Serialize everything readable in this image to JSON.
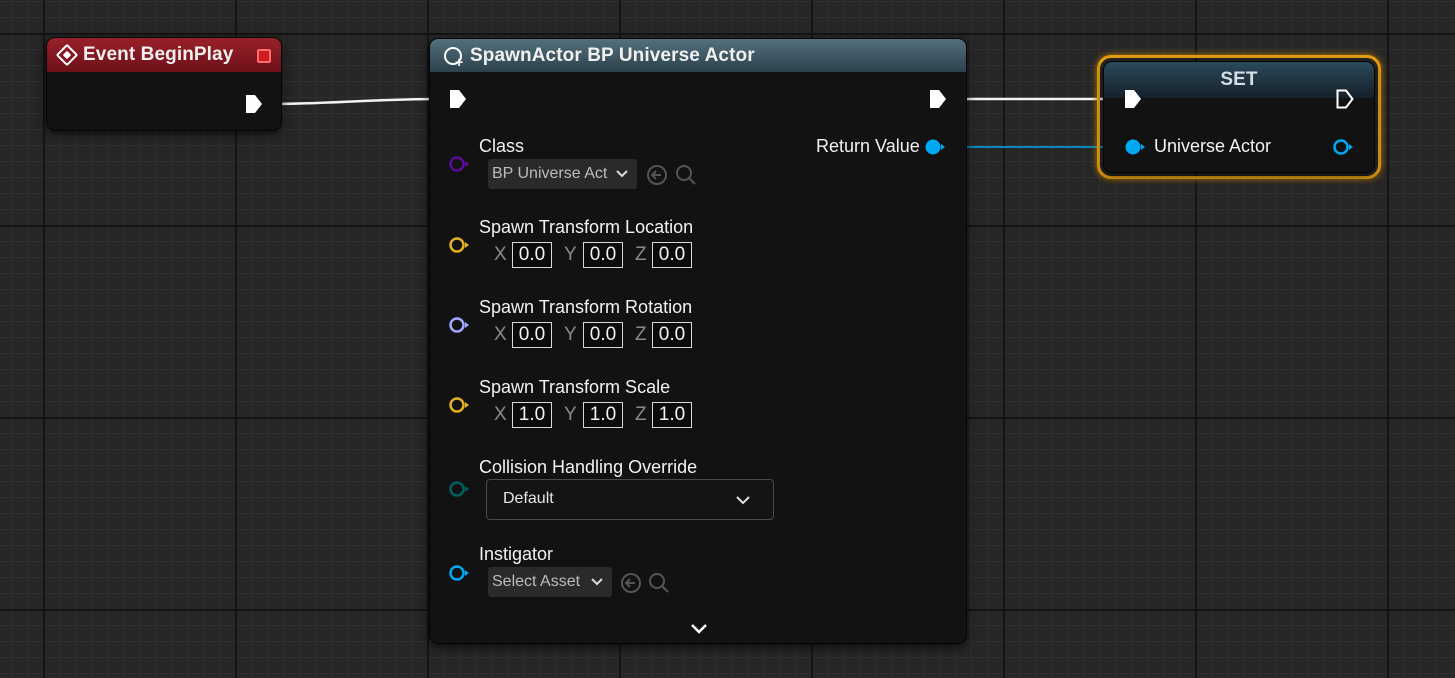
{
  "event_node": {
    "title": "Event BeginPlay"
  },
  "spawn_node": {
    "title": "SpawnActor BP Universe Actor",
    "class_label": "Class",
    "class_value": "BP Universe Act",
    "return_label": "Return Value",
    "location": {
      "label": "Spawn Transform Location",
      "x": "0.0",
      "y": "0.0",
      "z": "0.0"
    },
    "rotation": {
      "label": "Spawn Transform Rotation",
      "x": "0.0",
      "y": "0.0",
      "z": "0.0"
    },
    "scale": {
      "label": "Spawn Transform Scale",
      "x": "1.0",
      "y": "1.0",
      "z": "1.0"
    },
    "axis_labels": {
      "x": "X",
      "y": "Y",
      "z": "Z"
    },
    "collision": {
      "label": "Collision Handling Override",
      "value": "Default"
    },
    "instigator": {
      "label": "Instigator",
      "value": "Select Asset"
    }
  },
  "set_node": {
    "title": "SET",
    "var_label": "Universe Actor"
  },
  "colors": {
    "event_header": "#98202a",
    "function_header": "#53707d",
    "set_header": "#2a4a5a",
    "selection_outline": "#e8a10f",
    "object_pin": "#00a8f2",
    "class_pin": "#5b0a9a",
    "vector_pin": "#e0b020",
    "rotator_pin": "#9fa6ff",
    "enum_pin": "#006060"
  },
  "icons": [
    "event-icon",
    "stop-icon",
    "spawn-icon",
    "exec-pin-icon",
    "chevron-down-icon",
    "browse-arrow-icon",
    "search-icon",
    "expand-chevron-icon"
  ]
}
